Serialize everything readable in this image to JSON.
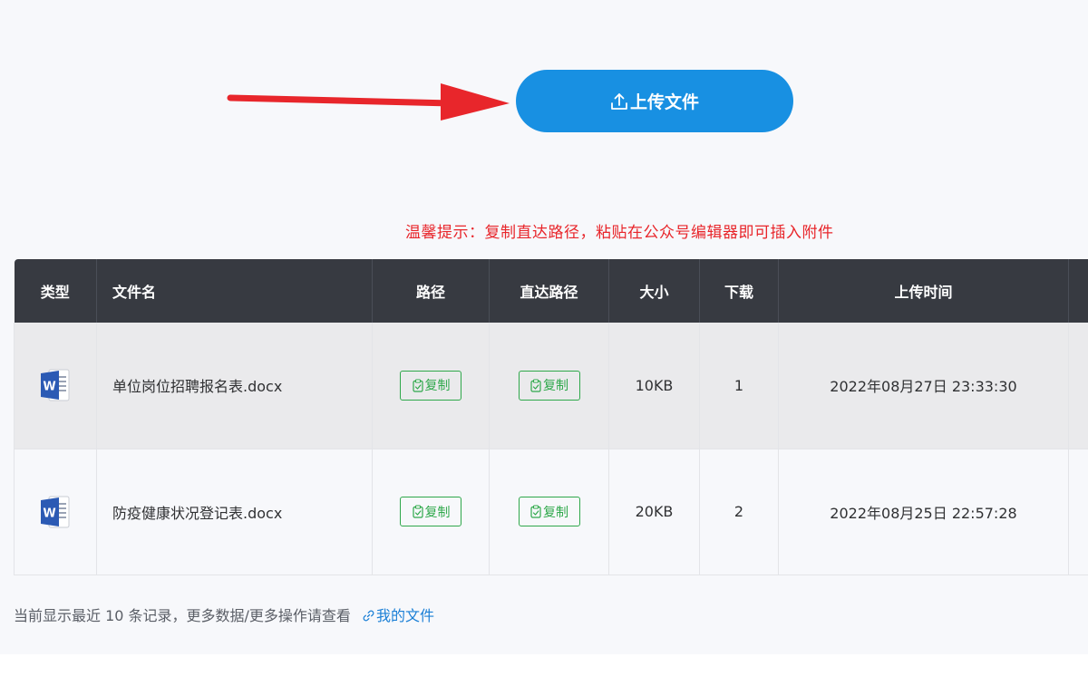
{
  "upload": {
    "label": "上传文件",
    "icon": "upload-icon",
    "color": "#1890e2"
  },
  "tip": {
    "text": "温馨提示：复制直达路径，粘贴在公众号编辑器即可插入附件",
    "color": "#e8262b"
  },
  "table": {
    "headers": {
      "type": "类型",
      "filename": "文件名",
      "path": "路径",
      "direct_path": "直达路径",
      "size": "大小",
      "downloads": "下载",
      "uploaded": "上传时间"
    },
    "rows": [
      {
        "type_icon": "word-icon",
        "filename": "单位岗位招聘报名表.docx",
        "path_button": "复制",
        "direct_button": "复制",
        "size": "10KB",
        "downloads": "1",
        "uploaded": "2022年08月27日 23:33:30"
      },
      {
        "type_icon": "word-icon",
        "filename": "防疫健康状况登记表.docx",
        "path_button": "复制",
        "direct_button": "复制",
        "size": "20KB",
        "downloads": "2",
        "uploaded": "2022年08月25日 22:57:28"
      }
    ]
  },
  "footer": {
    "text": "当前显示最近 10 条记录，更多数据/更多操作请查看",
    "link_label": "我的文件",
    "link_icon": "link-icon"
  },
  "colors": {
    "header_bg": "#373a41",
    "copy_green": "#2fa84b",
    "link_blue": "#1a7fd6"
  }
}
